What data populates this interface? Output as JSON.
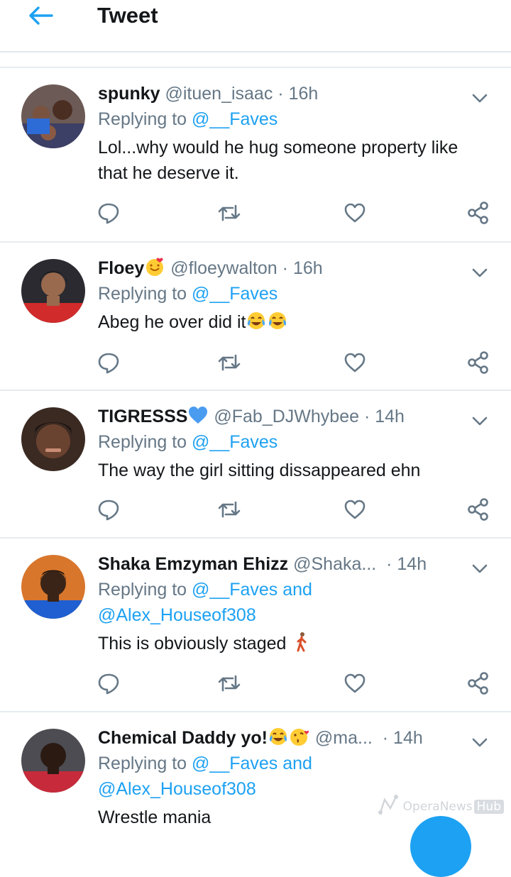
{
  "header": {
    "title": "Tweet"
  },
  "tweets": [
    {
      "display_name": "spunky",
      "handle": "@ituen_isaac",
      "dot": "·",
      "time": "16h",
      "reply_prefix": "Replying to",
      "reply_to": "@__Faves",
      "text": "Lol...why would he hug someone property like that he deserve it."
    },
    {
      "display_name": "Floey",
      "name_emoji": "smiling-face-with-hearts",
      "handle": "@floeywalton",
      "dot": "·",
      "time": "16h",
      "reply_prefix": "Replying to",
      "reply_to": "@__Faves",
      "text": "Abeg he over did it",
      "text_emojis": [
        "face-with-tears-of-joy",
        "face-with-tears-of-joy"
      ]
    },
    {
      "display_name": "TIGRESSS",
      "name_emoji": "blue-heart",
      "handle": "@Fab_DJWhybee",
      "dot": "·",
      "time": "14h",
      "reply_prefix": "Replying to",
      "reply_to": "@__Faves",
      "text": "The way the girl sitting dissappeared ehn"
    },
    {
      "display_name": "Shaka Emzyman Ehizz",
      "handle": "@Shaka...",
      "dot": "·",
      "time": "14h",
      "reply_prefix": "Replying to",
      "reply_to": "@__Faves and",
      "reply_to_2": "@Alex_Houseof308",
      "text": "This is obviously staged",
      "text_emojis": [
        "person-walking"
      ]
    },
    {
      "display_name": "Chemical Daddy yo!",
      "name_emojis": [
        "face-with-tears-of-joy",
        "face-blowing-a-kiss"
      ],
      "handle": "@ma...",
      "dot": "·",
      "time": "14h",
      "reply_prefix": "Replying to",
      "reply_to": "@__Faves and",
      "reply_to_2": "@Alex_Houseof308",
      "text": "Wrestle mania"
    }
  ],
  "icons": {
    "back": "arrow-left-icon",
    "caret": "chevron-down-icon",
    "reply": "reply-icon",
    "retweet": "retweet-icon",
    "like": "heart-icon",
    "share": "share-icon"
  },
  "watermark": {
    "text": "OperaNews",
    "badge": "Hub"
  },
  "colors": {
    "accent": "#1da1f2",
    "secondary_text": "#657786",
    "divider": "#e6ecf0"
  }
}
